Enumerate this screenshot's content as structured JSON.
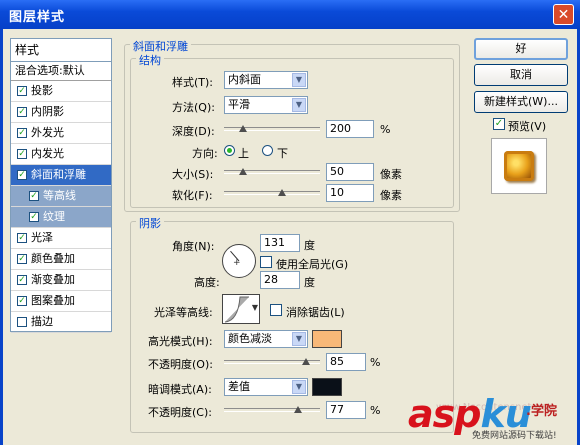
{
  "window": {
    "title": "图层样式",
    "close_glyph": "✕"
  },
  "styles_panel": {
    "header": "样式",
    "mixing_options": "混合选项:默认",
    "items": [
      {
        "label": "投影",
        "checked": true
      },
      {
        "label": "内阴影",
        "checked": true
      },
      {
        "label": "外发光",
        "checked": true
      },
      {
        "label": "内发光",
        "checked": true
      },
      {
        "label": "斜面和浮雕",
        "checked": true,
        "selected": true
      },
      {
        "label": "等高线",
        "checked": true,
        "sub": true
      },
      {
        "label": "纹理",
        "checked": true,
        "sub": true
      },
      {
        "label": "光泽",
        "checked": true
      },
      {
        "label": "颜色叠加",
        "checked": true
      },
      {
        "label": "渐变叠加",
        "checked": true
      },
      {
        "label": "图案叠加",
        "checked": true
      },
      {
        "label": "描边",
        "checked": false
      }
    ]
  },
  "bevel": {
    "section_title": "斜面和浮雕",
    "structure_title": "结构",
    "style_label": "样式(T):",
    "style_value": "内斜面",
    "technique_label": "方法(Q):",
    "technique_value": "平滑",
    "depth_label": "深度(D):",
    "depth_value": "200",
    "depth_unit": "%",
    "depth_slider_fraction": 0.2,
    "direction_label": "方向:",
    "direction_up": "上",
    "direction_down": "下",
    "direction_selected": "up",
    "size_label": "大小(S):",
    "size_value": "50",
    "size_unit": "像素",
    "size_slider_fraction": 0.2,
    "soften_label": "软化(F):",
    "soften_value": "10",
    "soften_unit": "像素",
    "soften_slider_fraction": 0.6
  },
  "shading": {
    "section_title": "阴影",
    "angle_label": "角度(N):",
    "angle_value": "131",
    "angle_unit": "度",
    "global_light_label": "使用全局光(G)",
    "global_light_checked": false,
    "altitude_label": "高度:",
    "altitude_value": "28",
    "altitude_unit": "度",
    "gloss_contour_label": "光泽等高线:",
    "anti_alias_label": "消除锯齿(L)",
    "anti_alias_checked": false,
    "highlight_mode_label": "高光模式(H):",
    "highlight_mode_value": "颜色减淡",
    "highlight_color": "#f8b878",
    "highlight_opacity_label": "不透明度(O):",
    "highlight_opacity_value": "85",
    "highlight_opacity_unit": "%",
    "highlight_opacity_fraction": 0.85,
    "shadow_mode_label": "暗调模式(A):",
    "shadow_mode_value": "差值",
    "shadow_color": "#0a1018",
    "shadow_opacity_label": "不透明度(C):",
    "shadow_opacity_value": "77",
    "shadow_opacity_unit": "%",
    "shadow_opacity_fraction": 0.77
  },
  "buttons": {
    "ok": "好",
    "cancel": "取消",
    "new_style": "新建样式(W)...",
    "preview_label": "预览(V)",
    "preview_checked": true
  },
  "watermark": {
    "brand_red": "asp",
    "brand_blue": "ku",
    "brand_tail": ".学院",
    "subtitle": "免费网站源码下载站!",
    "url": "www.Nscontensnet.net"
  }
}
